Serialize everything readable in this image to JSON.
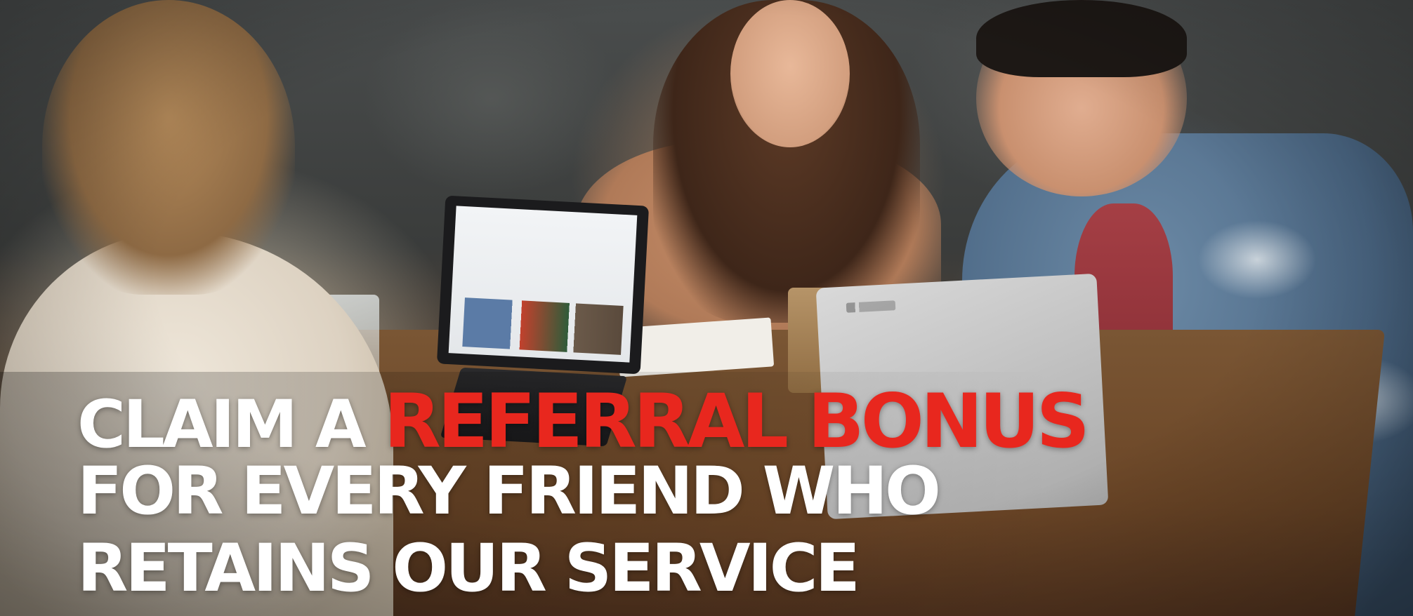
{
  "banner": {
    "headline": {
      "line1_prefix": "CLAIM A",
      "line1_highlight": "REFERRAL BONUS",
      "line2": "FOR EVERY FRIEND WHO",
      "line3": "RETAINS OUR SERVICE"
    },
    "colors": {
      "text": "#ffffff",
      "highlight": "#e8271e"
    }
  }
}
